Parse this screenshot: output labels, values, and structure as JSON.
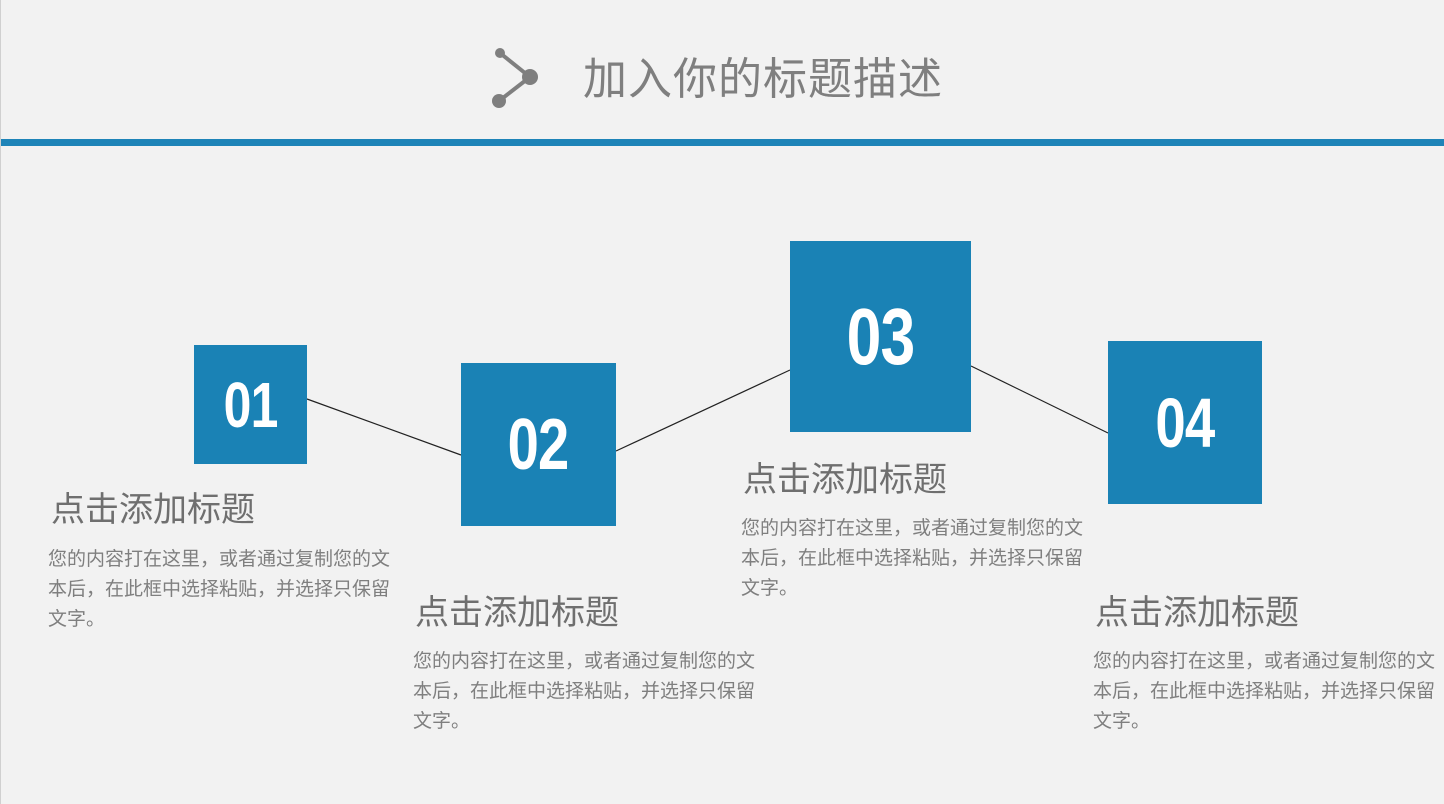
{
  "header": {
    "title": "加入你的标题描述",
    "icon": "share-node-icon",
    "rule_color": "#1e84b8"
  },
  "colors": {
    "accent": "#1a82b5",
    "text": "#7f7f7f",
    "background": "#f2f2f2"
  },
  "steps": [
    {
      "number": "01",
      "title": "点击添加标题",
      "description": "您的内容打在这里，或者通过复制您的文本后，在此框中选择粘贴，并选择只保留文字。"
    },
    {
      "number": "02",
      "title": "点击添加标题",
      "description": "您的内容打在这里，或者通过复制您的文本后，在此框中选择粘贴，并选择只保留文字。"
    },
    {
      "number": "03",
      "title": "点击添加标题",
      "description": "您的内容打在这里，或者通过复制您的文本后，在此框中选择粘贴，并选择只保留文字。"
    },
    {
      "number": "04",
      "title": "点击添加标题",
      "description": "您的内容打在这里，或者通过复制您的文本后，在此框中选择粘贴，并选择只保留文字。"
    }
  ]
}
